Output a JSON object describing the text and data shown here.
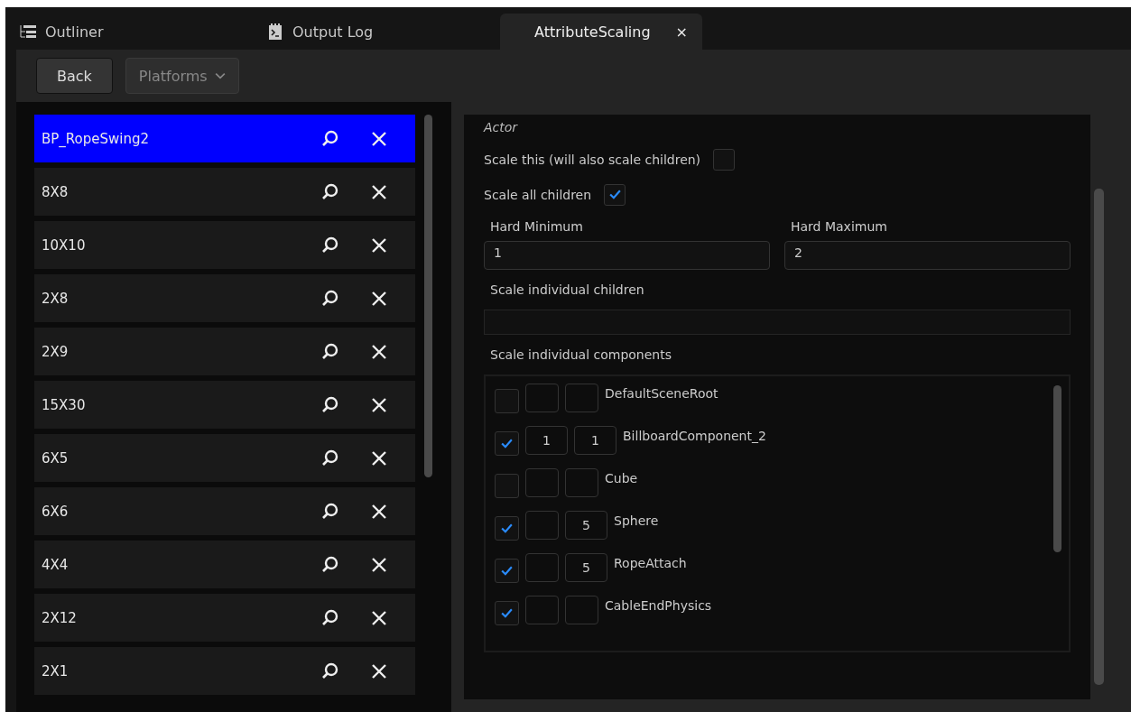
{
  "tabs": [
    {
      "label": "Outliner",
      "selected": false
    },
    {
      "label": "Output Log",
      "selected": false
    },
    {
      "label": "AttributeScaling",
      "selected": true,
      "close": "×"
    }
  ],
  "toolbar": {
    "back": "Back",
    "platforms": "Platforms"
  },
  "actors": [
    {
      "name": "BP_RopeSwing2",
      "selected": true
    },
    {
      "name": "8X8",
      "selected": false
    },
    {
      "name": "10X10",
      "selected": false
    },
    {
      "name": "2X8",
      "selected": false
    },
    {
      "name": "2X9",
      "selected": false
    },
    {
      "name": "15X30",
      "selected": false
    },
    {
      "name": "6X5",
      "selected": false
    },
    {
      "name": "6X6",
      "selected": false
    },
    {
      "name": "4X4",
      "selected": false
    },
    {
      "name": "2X12",
      "selected": false
    },
    {
      "name": "2X1",
      "selected": false
    }
  ],
  "details": {
    "heading": "Actor",
    "scale_this": {
      "label": "Scale this (will also scale children)",
      "checked": false
    },
    "scale_all_children": {
      "label": "Scale all children",
      "checked": true
    },
    "hard_minimum": {
      "label": "Hard Minimum",
      "value": "1"
    },
    "hard_maximum": {
      "label": "Hard Maximum",
      "value": "2"
    },
    "individual_children_label": "Scale individual children",
    "individual_components_label": "Scale individual components",
    "components": [
      {
        "name": "DefaultSceneRoot",
        "checked": false
      },
      {
        "name": "BillboardComponent_2",
        "checked": true,
        "min": "1",
        "max": "1"
      },
      {
        "name": "Cube",
        "checked": false
      },
      {
        "name": "Sphere",
        "checked": true,
        "max": "5"
      },
      {
        "name": "RopeAttach",
        "checked": true,
        "max": "5"
      },
      {
        "name": "CableEndPhysics",
        "checked": true
      }
    ]
  }
}
